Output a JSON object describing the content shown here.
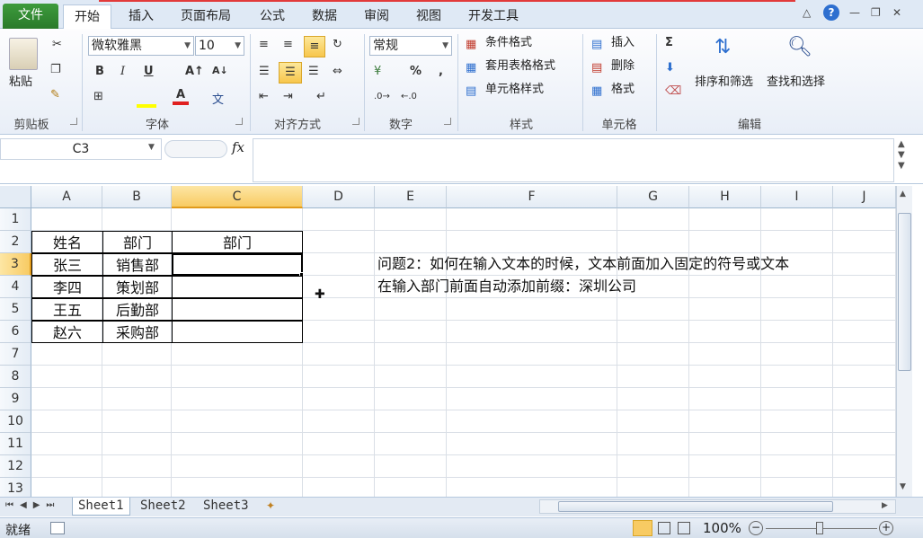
{
  "tabs": [
    "文件",
    "开始",
    "插入",
    "页面布局",
    "公式",
    "数据",
    "审阅",
    "视图",
    "开发工具"
  ],
  "ribbon": {
    "clipboard": {
      "paste": "粘贴",
      "label": "剪贴板"
    },
    "font": {
      "name": "微软雅黑",
      "size": "10",
      "label": "字体",
      "bold": "B",
      "italic": "I",
      "underline": "U"
    },
    "align": {
      "label": "对齐方式"
    },
    "number": {
      "format": "常规",
      "percent": "%",
      "comma": ",",
      "label": "数字"
    },
    "styles": {
      "cond": "条件格式",
      "table": "套用表格格式",
      "cell": "单元格样式",
      "label": "样式"
    },
    "cells": {
      "insert": "插入",
      "delete": "删除",
      "format": "格式",
      "label": "单元格"
    },
    "editing": {
      "sum": "Σ",
      "sort": "排序和筛选",
      "find": "查找和选择",
      "label": "编辑"
    }
  },
  "formula": {
    "namebox": "C3",
    "fx": "fx",
    "value": ""
  },
  "columns": [
    "A",
    "B",
    "C",
    "D",
    "E",
    "F",
    "G",
    "H",
    "I",
    "J"
  ],
  "rows": [
    "1",
    "2",
    "3",
    "4",
    "5",
    "6",
    "7",
    "8",
    "9",
    "10",
    "11",
    "12",
    "13"
  ],
  "table": {
    "header": [
      "姓名",
      "部门",
      "部门"
    ],
    "rows": [
      [
        "张三",
        "销售部",
        ""
      ],
      [
        "李四",
        "策划部",
        ""
      ],
      [
        "王五",
        "后勤部",
        ""
      ],
      [
        "赵六",
        "采购部",
        ""
      ]
    ]
  },
  "notes": [
    "问题2：如何在输入文本的时候，文本前面加入固定的符号或文本",
    "在输入部门前面自动添加前缀：深圳公司"
  ],
  "sheets": [
    "Sheet1",
    "Sheet2",
    "Sheet3"
  ],
  "status": {
    "ready": "就绪",
    "zoom": "100%"
  },
  "colors": {
    "file_tab": "#2a7a2a",
    "selection": "#f8cb63",
    "accent": "#b6c8de"
  }
}
